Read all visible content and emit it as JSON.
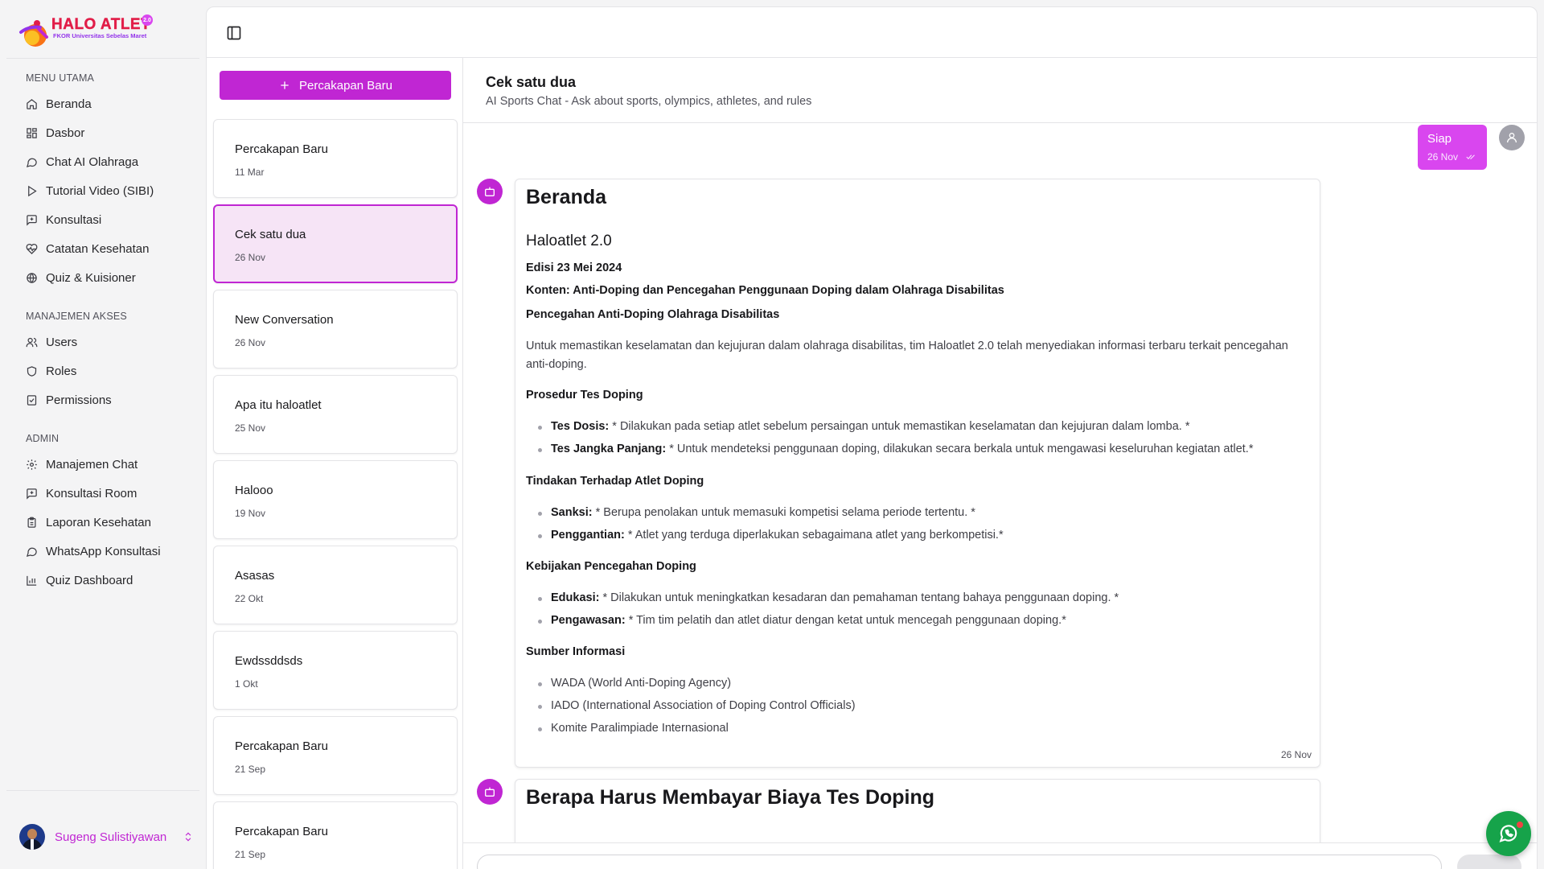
{
  "brand": {
    "title": "HALO ATLET",
    "subtitle": "FKOR Universitas Sebelas Maret",
    "badge": "2.0"
  },
  "sidebar": {
    "sections": [
      {
        "label": "MENU UTAMA",
        "items": [
          {
            "label": "Beranda",
            "icon": "home-icon"
          },
          {
            "label": "Dasbor",
            "icon": "dashboard-icon"
          },
          {
            "label": "Chat AI Olahraga",
            "icon": "chat-icon"
          },
          {
            "label": "Tutorial Video (SIBI)",
            "icon": "play-icon"
          },
          {
            "label": "Konsultasi",
            "icon": "message-square-icon"
          },
          {
            "label": "Catatan Kesehatan",
            "icon": "heart-pulse-icon"
          },
          {
            "label": "Quiz & Kuisioner",
            "icon": "globe-icon"
          }
        ]
      },
      {
        "label": "MANAJEMEN AKSES",
        "items": [
          {
            "label": "Users",
            "icon": "users-icon"
          },
          {
            "label": "Roles",
            "icon": "shield-icon"
          },
          {
            "label": "Permissions",
            "icon": "checklist-icon"
          }
        ]
      },
      {
        "label": "ADMIN",
        "items": [
          {
            "label": "Manajemen Chat",
            "icon": "gear-icon"
          },
          {
            "label": "Konsultasi Room",
            "icon": "message-square-icon"
          },
          {
            "label": "Laporan Kesehatan",
            "icon": "clipboard-icon"
          },
          {
            "label": "WhatsApp Konsultasi",
            "icon": "chat-icon"
          },
          {
            "label": "Quiz Dashboard",
            "icon": "bar-chart-icon"
          }
        ]
      }
    ],
    "user": {
      "name": "Sugeng Sulistiyawan"
    }
  },
  "conversations": {
    "new_button": "Percakapan Baru",
    "items": [
      {
        "title": "Percakapan Baru",
        "date": "11 Mar"
      },
      {
        "title": "Cek satu dua",
        "date": "26 Nov"
      },
      {
        "title": "New Conversation",
        "date": "26 Nov"
      },
      {
        "title": "Apa itu haloatlet",
        "date": "25 Nov"
      },
      {
        "title": "Halooo",
        "date": "19 Nov"
      },
      {
        "title": "Asasas",
        "date": "22 Okt"
      },
      {
        "title": "Ewdssddsds",
        "date": "1 Okt"
      },
      {
        "title": "Percakapan Baru",
        "date": "21 Sep"
      },
      {
        "title": "Percakapan Baru",
        "date": "21 Sep"
      }
    ]
  },
  "chat": {
    "title": "Cek satu dua",
    "subtitle": "AI Sports Chat - Ask about sports, olympics, athletes, and rules",
    "user_message": {
      "text": "Siap",
      "time": "26 Nov"
    },
    "bot_message": {
      "h1": "Beranda",
      "h2": "Haloatlet 2.0",
      "edition": "Edisi 23 Mei 2024",
      "content": "Konten: Anti-Doping dan Pencegahan Penggunaan Doping dalam Olahraga Disabilitas",
      "section1": "Pencegahan Anti-Doping Olahraga Disabilitas",
      "paragraph": "Untuk memastikan keselamatan dan kejujuran dalam olahraga disabilitas, tim Haloatlet 2.0 telah menyediakan informasi terbaru terkait pencegahan anti-doping.",
      "s2": {
        "heading": "Prosedur Tes Doping",
        "items": [
          {
            "label": "Tes Dosis:",
            "text": " * Dilakukan pada setiap atlet sebelum persaingan untuk memastikan keselamatan dan kejujuran dalam lomba. *"
          },
          {
            "label": "Tes Jangka Panjang:",
            "text": " * Untuk mendeteksi penggunaan doping, dilakukan secara berkala untuk mengawasi keseluruhan kegiatan atlet.*"
          }
        ]
      },
      "s3": {
        "heading": "Tindakan Terhadap Atlet Doping",
        "items": [
          {
            "label": "Sanksi:",
            "text": " * Berupa penolakan untuk memasuki kompetisi selama periode tertentu. *"
          },
          {
            "label": "Penggantian:",
            "text": " * Atlet yang terduga diperlakukan sebagaimana atlet yang berkompetisi.*"
          }
        ]
      },
      "s4": {
        "heading": "Kebijakan Pencegahan Doping",
        "items": [
          {
            "label": "Edukasi:",
            "text": " * Dilakukan untuk meningkatkan kesadaran dan pemahaman tentang bahaya penggunaan doping. *"
          },
          {
            "label": "Pengawasan:",
            "text": " * Tim tim pelatih dan atlet diatur dengan ketat untuk mencegah penggunaan doping.*"
          }
        ]
      },
      "s5": {
        "heading": "Sumber Informasi",
        "items": [
          "WADA (World Anti-Doping Agency)",
          "IADO (International Association of Doping Control Officials)",
          "Komite Paralimpiade Internasional"
        ]
      },
      "time": "26 Nov"
    },
    "bot_message_2": {
      "h1": "Berapa Harus Membayar Biaya Tes Doping"
    }
  },
  "colors": {
    "accent": "#c026d3",
    "accent_light": "#d946ef",
    "whatsapp": "#16a34a"
  }
}
